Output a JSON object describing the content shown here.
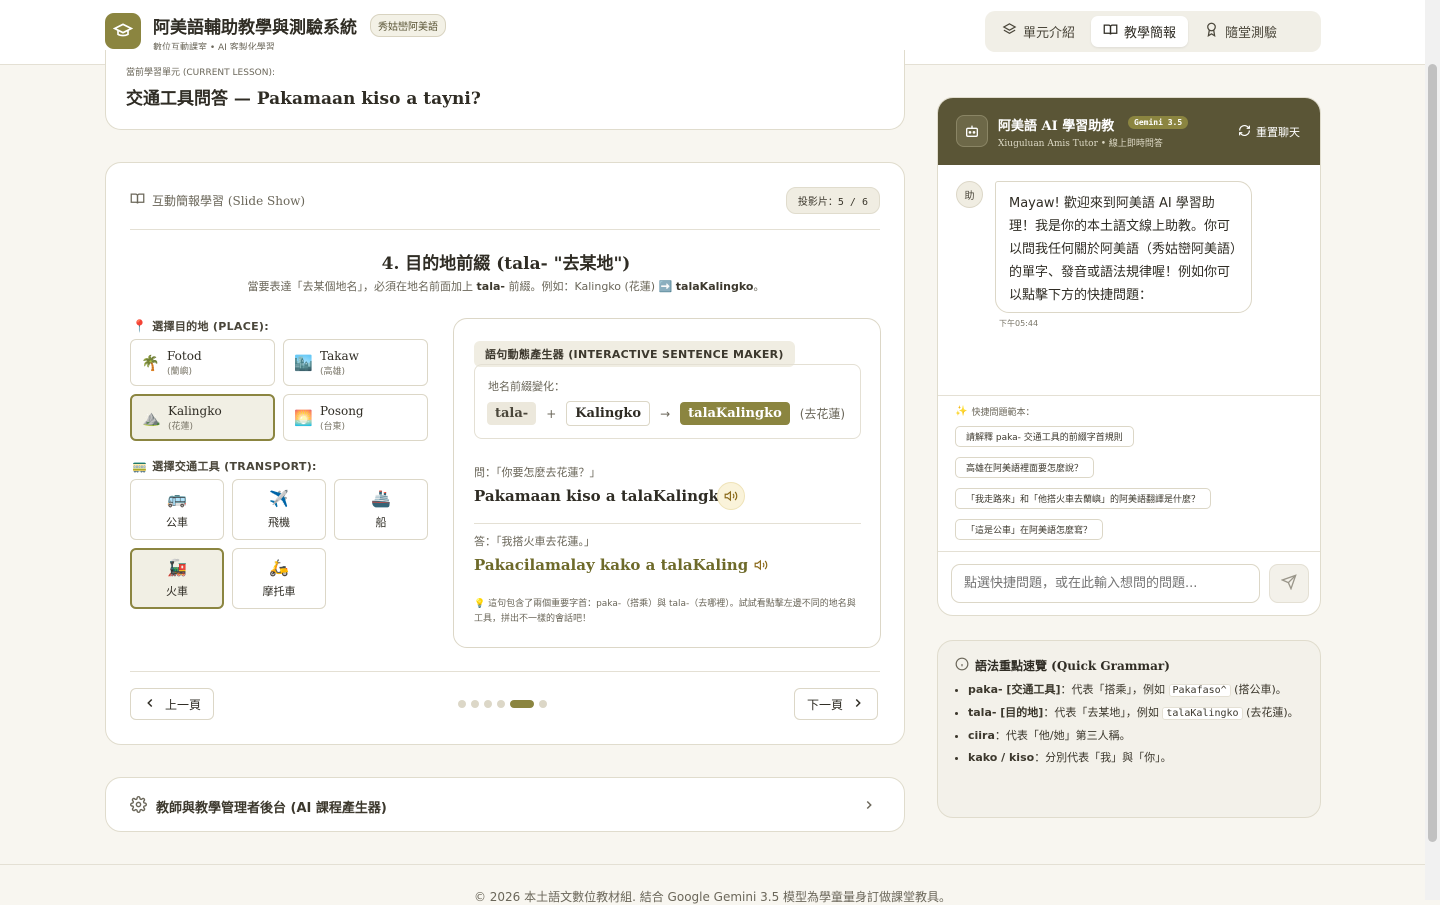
{
  "header": {
    "title": "阿美語輔助教學與測驗系統",
    "tag": "秀姑巒阿美語",
    "subtitle": "數位互動課室 • AI 客製化學習",
    "nav": [
      {
        "label": "單元介紹",
        "icon": "layers-icon"
      },
      {
        "label": "教學簡報",
        "icon": "book-open-icon",
        "active": true
      },
      {
        "label": "隨堂測驗",
        "icon": "award-icon"
      }
    ]
  },
  "lesson": {
    "label": "當前學習單元 (CURRENT LESSON):",
    "title": "交通工具問答 — Pakamaan kiso a tayni?"
  },
  "slide": {
    "header": "互動簡報學習 (Slide Show)",
    "counter": "投影片：5 / 6",
    "title": "4. 目的地前綴 (tala- \"去某地\")",
    "desc_before": "當要表達「去某個地名」，必須在地名前面加上 ",
    "desc_bold1": "tala-",
    "desc_mid": " 前綴。例如：Kalingko (花蓮) ➡️ ",
    "desc_bold2": "talaKalingko",
    "desc_after": "。",
    "place_label": "選擇目的地 (PLACE):",
    "places": [
      {
        "name": "Fotod",
        "zh": "(蘭嶼)",
        "emoji": "🌴"
      },
      {
        "name": "Takaw",
        "zh": "(高雄)",
        "emoji": "🏙️"
      },
      {
        "name": "Kalingko",
        "zh": "(花蓮)",
        "emoji": "⛰️",
        "selected": true
      },
      {
        "name": "Posong",
        "zh": "(台東)",
        "emoji": "🌅"
      }
    ],
    "transport_label": "選擇交通工具 (TRANSPORT):",
    "transports": [
      {
        "label": "公車",
        "emoji": "🚌"
      },
      {
        "label": "飛機",
        "emoji": "✈️"
      },
      {
        "label": "船",
        "emoji": "🚢"
      },
      {
        "label": "火車",
        "emoji": "🚂",
        "selected": true
      },
      {
        "label": "摩托車",
        "emoji": "🛵"
      }
    ],
    "maker": {
      "title": "語句動態產生器 (INTERACTIVE SENTENCE MAKER)",
      "prefix_label": "地名前綴變化：",
      "prefix": "tala-",
      "plus": "+",
      "place": "Kalingko",
      "arrow": "→",
      "result": "talaKalingko",
      "result_zh": "(去花蓮)",
      "q_label": "問：「你要怎麼去花蓮？」",
      "q_text": "Pakamaan kiso a talaKalingko?",
      "a_label": "答：「我搭火車去花蓮。」",
      "a_text": "Pakacilamalay kako a talaKalingko.",
      "tip": "💡 這句包含了兩個重要字首：paka-（搭乘）與 tala-（去哪裡）。試試看點擊左邊不同的地名與工具，拼出不一樣的會話吧！"
    },
    "prev": "上一頁",
    "next": "下一頁",
    "dots": 6,
    "active_dot": 4
  },
  "admin": {
    "label": "教師與教學管理者後台 (AI 課程產生器)"
  },
  "chat": {
    "title": "阿美語 AI 學習助教",
    "badge": "Gemini 3.5",
    "subtitle": "Xiuguluan Amis Tutor • 線上即時問答",
    "reset": "重置聊天",
    "avatar": "助",
    "message": "Mayaw! 歡迎來到阿美語 AI 學習助理！我是你的本土語文線上助教。你可以問我任何關於阿美語（秀姑巒阿美語）的單字、發音或語法規律喔！例如你可以點擊下方的快捷問題：",
    "time": "下午05:44",
    "quick_label": "快捷問題範本：",
    "quick": [
      "請解釋 paka- 交通工具的前綴字首規則",
      "高雄在阿美語裡面要怎麼說？",
      "「我走路來」和「他搭火車去蘭嶼」的阿美語翻譯是什麼？",
      "「這是公車」在阿美語怎麼寫？"
    ],
    "input_placeholder": "點選快捷問題，或在此輸入想問的問題..."
  },
  "grammar": {
    "title": "語法重點速覽 (Quick Grammar)",
    "items": [
      {
        "term": "paka- [交通工具]",
        "text1": "：代表「搭乘」，例如 ",
        "code": "Pakafaso^",
        "text2": " (搭公車)。"
      },
      {
        "term": "tala- [目的地]",
        "text1": "：代表「去某地」，例如 ",
        "code": "talaKalingko",
        "text2": " (去花蓮)。"
      },
      {
        "term": "ciira",
        "text1": "：代表「他/她」第三人稱。",
        "code": "",
        "text2": ""
      },
      {
        "term": "kako / kiso",
        "text1": "：分別代表「我」與「你」。",
        "code": "",
        "text2": ""
      }
    ]
  },
  "footer": "© 2026 本土語文數位教材組. 結合 Google Gemini 3.5 模型為學童量身訂做課堂教具。",
  "colors": {
    "accent": "#8b8540",
    "header_dark": "#5a5536",
    "bg": "#f8f6f0"
  }
}
